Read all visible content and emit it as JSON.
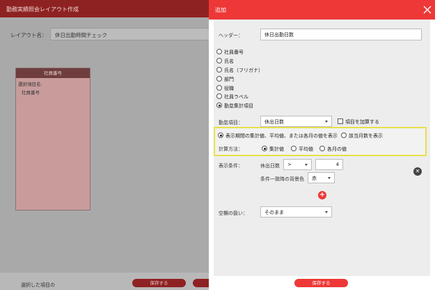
{
  "background": {
    "title": "勤務実績照会レイアウト作成",
    "layout_name_label": "レイアウト名：",
    "layout_name_value": "休日出勤時間チェック",
    "card": {
      "header": "社員番号",
      "line1": "選択項目名:",
      "line2": "社員番号"
    },
    "footer_text": "選択した項目の",
    "save_label": "保存する"
  },
  "panel": {
    "title": "追加",
    "header_label": "ヘッダー：",
    "header_value": "休日出勤日数",
    "item_types": [
      {
        "label": "社員番号",
        "selected": false
      },
      {
        "label": "氏名",
        "selected": false
      },
      {
        "label": "氏名（フリガナ）",
        "selected": false
      },
      {
        "label": "部門",
        "selected": false
      },
      {
        "label": "役職",
        "selected": false
      },
      {
        "label": "社員ラベル",
        "selected": false
      },
      {
        "label": "勤怠集計項目",
        "selected": true
      }
    ],
    "attendance_item_label": "勤怠項目：",
    "attendance_item_value": "休出日数",
    "add_item_checkbox_label": "項目を加算する",
    "display_mode": [
      {
        "label": "表示期間の集計値、平均値、または各月の値を表示",
        "selected": true
      },
      {
        "label": "該当月数を表示",
        "selected": false
      }
    ],
    "calc_method_label": "計算方法：",
    "calc_methods": [
      {
        "label": "集計値",
        "selected": true
      },
      {
        "label": "平均値",
        "selected": false
      },
      {
        "label": "各月の値",
        "selected": false
      }
    ],
    "display_condition_label": "表示条件：",
    "condition_item": "休出日数",
    "condition_operator": ">",
    "condition_value": "4",
    "bg_color_label": "条件一致時の背景色",
    "bg_color_value": "赤",
    "empty_handling_label": "空欄の扱い：",
    "empty_handling_value": "そのまま",
    "save_label": "保存する"
  },
  "colors": {
    "accent": "#ee3838",
    "highlight": "#e8e04a"
  }
}
